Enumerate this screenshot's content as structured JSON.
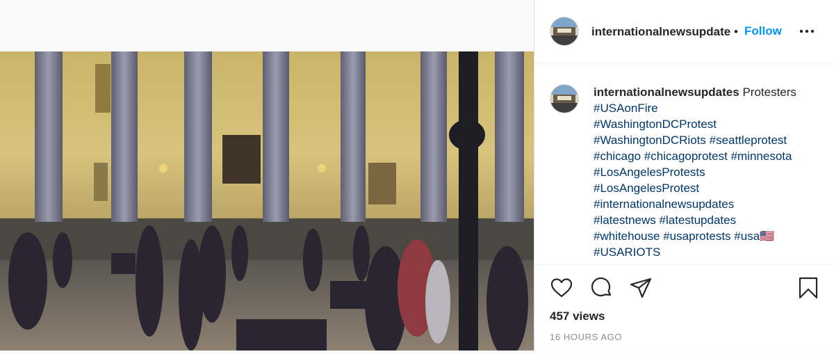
{
  "header": {
    "username": "internationalnewsupdates",
    "separator": "•",
    "follow_label": "Follow",
    "more_icon": "more-icon"
  },
  "caption": {
    "username": "internationalnewsupdates",
    "text": "Protesters",
    "lines": [
      [
        "#USAonFire"
      ],
      [
        "#WashingtonDCProtest"
      ],
      [
        "#WashingtonDCRiots",
        "#seattleprotest"
      ],
      [
        "#chicago",
        "#chicagoprotest",
        "#minnesota"
      ],
      [
        "#LosAngelesProtests"
      ],
      [
        "#LosAngelesProtest"
      ],
      [
        "#internationalnewsupdates"
      ],
      [
        "#latestnews",
        "#latestupdates"
      ],
      [
        "#whitehouse",
        "#usaprotests",
        "#usa🇺🇸"
      ],
      [
        "#USARIOTS"
      ]
    ]
  },
  "actions": {
    "icons": [
      "heart-icon",
      "comment-icon",
      "share-icon",
      "bookmark-icon"
    ],
    "views": "457 views",
    "time_ago": "16 HOURS AGO"
  },
  "colors": {
    "link": "#00376b",
    "follow": "#0095f6",
    "muted": "#8e8e8e"
  }
}
